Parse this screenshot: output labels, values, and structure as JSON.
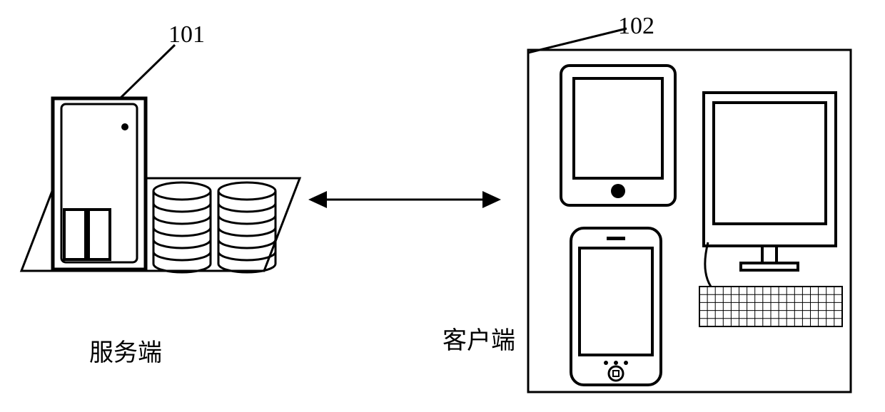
{
  "labels": {
    "server_num": "101",
    "client_num": "102",
    "server_text": "服务端",
    "client_text": "客户端"
  }
}
